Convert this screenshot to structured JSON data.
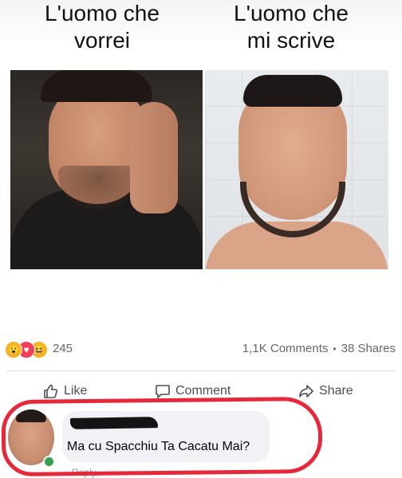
{
  "meme": {
    "left_caption": [
      "L'uomo che",
      "vorrei"
    ],
    "right_caption": [
      "L'uomo che",
      "mi scrive"
    ]
  },
  "reactions": {
    "icons": [
      "wow-emoji-icon",
      "love-heart-icon",
      "haha-emoji-icon"
    ],
    "count": "245",
    "comments": "1,1K Comments",
    "separator": "•",
    "shares": "38 Shares"
  },
  "actions": {
    "like_label": "Like",
    "comment_label": "Comment",
    "share_label": "Share"
  },
  "comment": {
    "text": "Ma cu Spacchiu Ta Cacatu Mai?",
    "meta": "Reply"
  },
  "colors": {
    "highlight": "#e5283a",
    "online_status": "#31a24c",
    "secondary_text": "#65676b"
  }
}
